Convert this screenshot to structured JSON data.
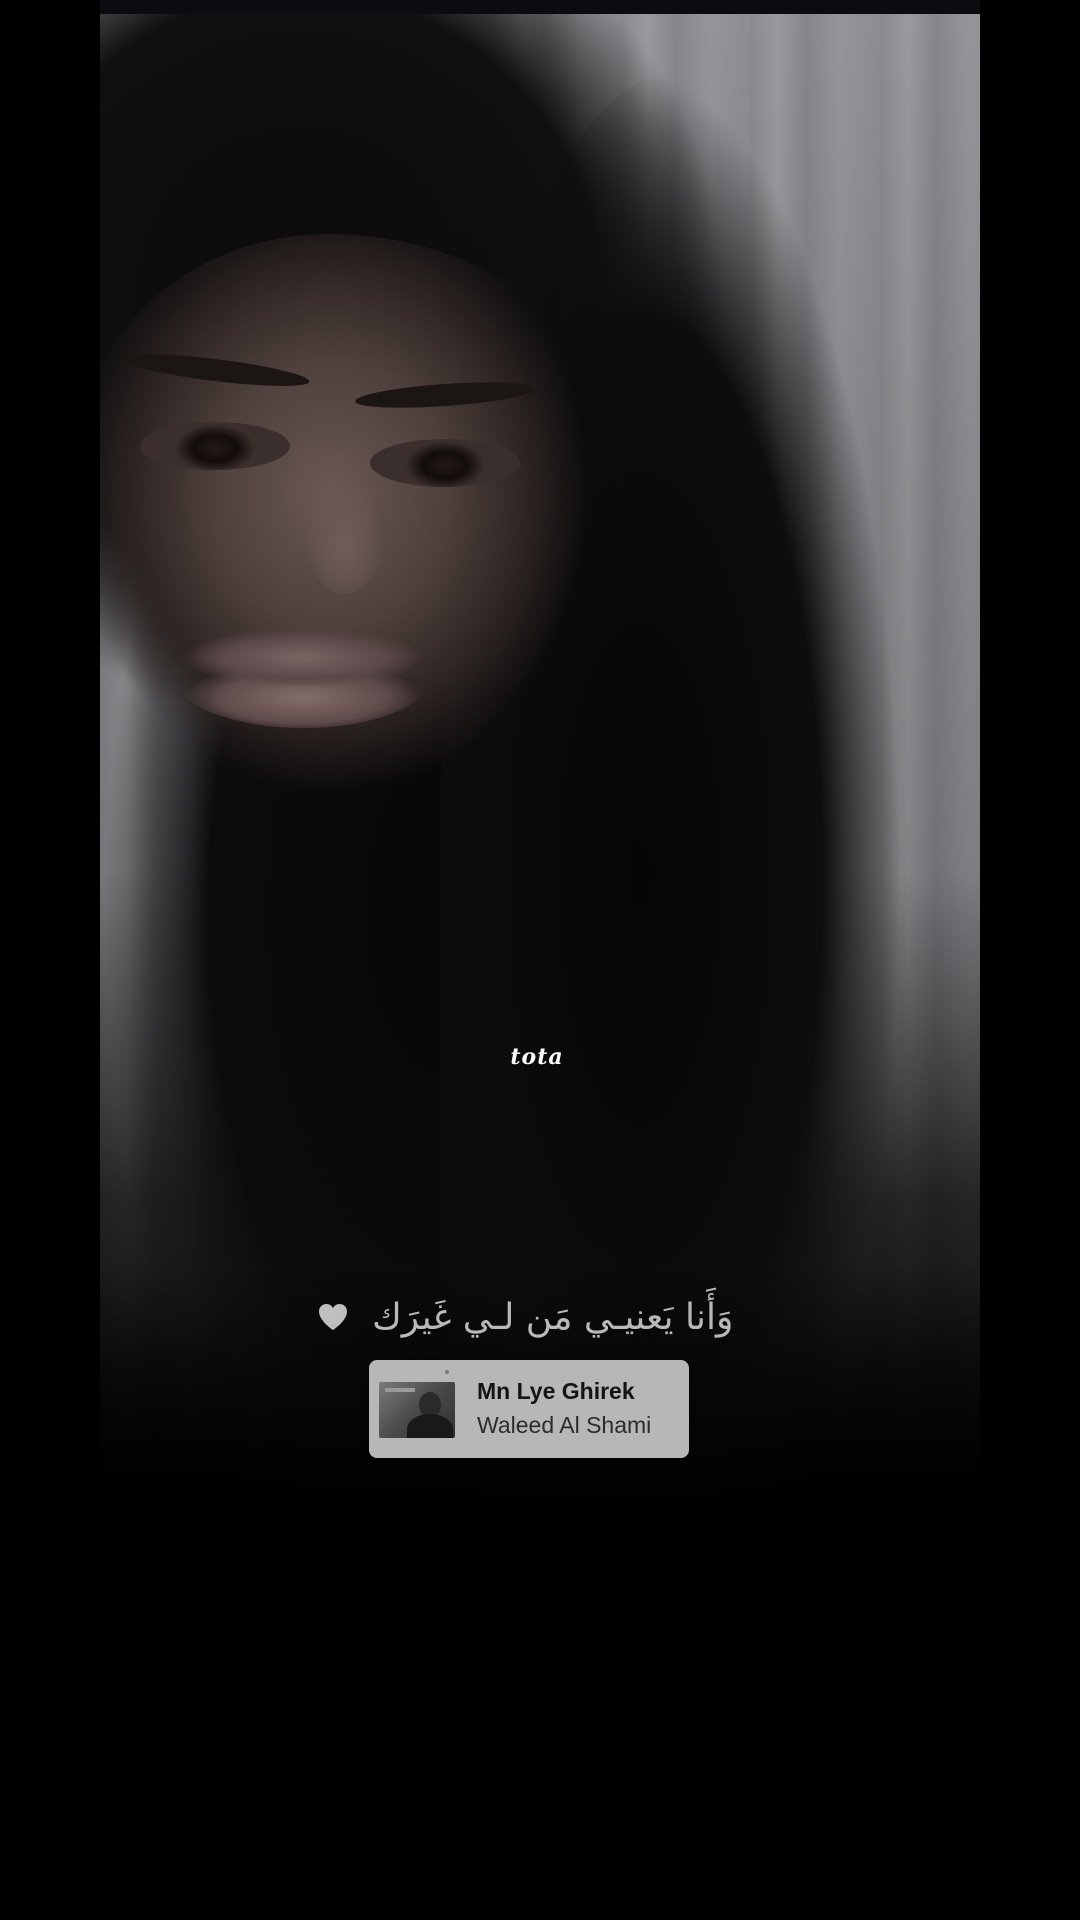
{
  "watermark": {
    "text": "tota"
  },
  "lyric": {
    "text": "وَأَنا يَعنيـي مَن لـي غَيرَك"
  },
  "heart_icon": {
    "icon": "heart-icon",
    "color": "#bfbfbf"
  },
  "music_sticker": {
    "title": "Mn Lye Ghirek",
    "artist": "Waleed Al Shami",
    "background": "#b7b7b7"
  }
}
